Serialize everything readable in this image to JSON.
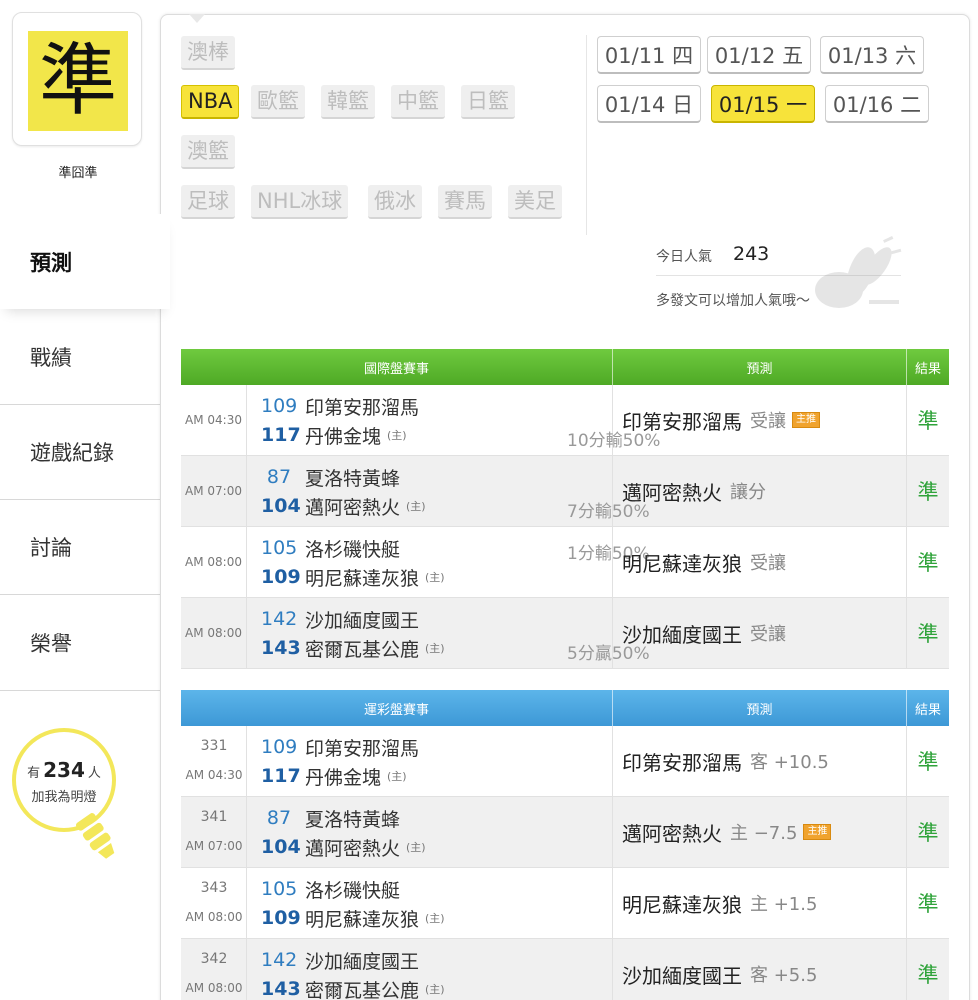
{
  "user": {
    "avatar_char": "準",
    "name": "準囧準"
  },
  "nav": [
    {
      "label": "預測",
      "active": true
    },
    {
      "label": "戰績",
      "active": false
    },
    {
      "label": "遊戲紀錄",
      "active": false
    },
    {
      "label": "討論",
      "active": false
    },
    {
      "label": "榮譽",
      "active": false
    }
  ],
  "fans": {
    "prefix": "有",
    "count": "234",
    "suffix": "人",
    "line2": "加我為明燈"
  },
  "sports": {
    "row1": [
      "澳棒"
    ],
    "row2": [
      "NBA",
      "歐籃",
      "韓籃",
      "中籃",
      "日籃"
    ],
    "row3": [
      "澳籃"
    ],
    "row4": [
      "足球",
      "NHL冰球",
      "俄冰",
      "賽馬",
      "美足"
    ],
    "active": "NBA"
  },
  "dates": {
    "row1": [
      "01/11 四",
      "01/12 五",
      "01/13 六"
    ],
    "row2": [
      "01/14 日",
      "01/15 一",
      "01/16 二"
    ],
    "active": "01/15 一"
  },
  "popularity": {
    "label": "今日人氣",
    "value": "243",
    "note": "多發文可以增加人氣哦～"
  },
  "intl": {
    "headers": {
      "game": "國際盤賽事",
      "pred": "預測",
      "result": "結果"
    },
    "rows": [
      {
        "time": "AM 04:30",
        "n1": "109",
        "t1": "印第安那溜馬",
        "h1": "",
        "n2": "117",
        "t2": "丹佛金塊",
        "h2": "(主)",
        "odds": "10分輸50%",
        "odds_row": 2,
        "pred": "印第安那溜馬",
        "pred_sub": "受讓",
        "tag": "主推",
        "result": "準"
      },
      {
        "time": "AM 07:00",
        "n1": "87",
        "t1": "夏洛特黃蜂",
        "h1": "",
        "n2": "104",
        "t2": "邁阿密熱火",
        "h2": "(主)",
        "odds": "7分輸50%",
        "odds_row": 2,
        "pred": "邁阿密熱火",
        "pred_sub": "讓分",
        "tag": "",
        "result": "準"
      },
      {
        "time": "AM 08:00",
        "n1": "105",
        "t1": "洛杉磯快艇",
        "h1": "",
        "n2": "109",
        "t2": "明尼蘇達灰狼",
        "h2": "(主)",
        "odds": "1分輸50%",
        "odds_row": 1,
        "pred": "明尼蘇達灰狼",
        "pred_sub": "受讓",
        "tag": "",
        "result": "準"
      },
      {
        "time": "AM 08:00",
        "n1": "142",
        "t1": "沙加緬度國王",
        "h1": "",
        "n2": "143",
        "t2": "密爾瓦基公鹿",
        "h2": "(主)",
        "odds": "5分贏50%",
        "odds_row": 2,
        "pred": "沙加緬度國王",
        "pred_sub": "受讓",
        "tag": "",
        "result": "準"
      }
    ]
  },
  "lottery": {
    "headers": {
      "game": "運彩盤賽事",
      "pred": "預測",
      "result": "結果"
    },
    "rows": [
      {
        "no": "331",
        "time": "AM 04:30",
        "n1": "109",
        "t1": "印第安那溜馬",
        "n2": "117",
        "t2": "丹佛金塊",
        "h2": "(主)",
        "pred": "印第安那溜馬",
        "pred_sub": "客 +10.5",
        "tag": "",
        "result": "準"
      },
      {
        "no": "341",
        "time": "AM 07:00",
        "n1": "87",
        "t1": "夏洛特黃蜂",
        "n2": "104",
        "t2": "邁阿密熱火",
        "h2": "(主)",
        "pred": "邁阿密熱火",
        "pred_sub": "主 −7.5",
        "tag": "主推",
        "result": "準"
      },
      {
        "no": "343",
        "time": "AM 08:00",
        "n1": "105",
        "t1": "洛杉磯快艇",
        "n2": "109",
        "t2": "明尼蘇達灰狼",
        "h2": "(主)",
        "pred": "明尼蘇達灰狼",
        "pred_sub": "主 +1.5",
        "tag": "",
        "result": "準"
      },
      {
        "no": "342",
        "time": "AM 08:00",
        "n1": "142",
        "t1": "沙加緬度國王",
        "n2": "143",
        "t2": "密爾瓦基公鹿",
        "h2": "(主)",
        "pred": "沙加緬度國王",
        "pred_sub": "客 +5.5",
        "tag": "",
        "result": "準"
      }
    ]
  }
}
